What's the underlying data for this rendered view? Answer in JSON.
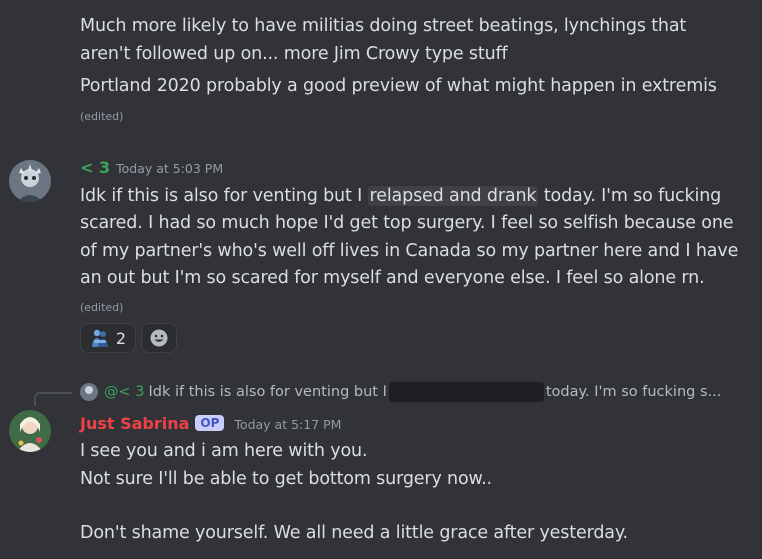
{
  "messages": {
    "prev": {
      "lines": [
        "Much more likely to have militias doing street beatings, lynchings that",
        "aren't followed up on... more Jim Crowy type stuff",
        "Portland 2020 probably a good preview of what might happen in extremis"
      ],
      "edited": "(edited)"
    },
    "lt3": {
      "username": "< 3",
      "username_color": "#3ba55c",
      "timestamp": "Today at 5:03 PM",
      "line1_before": "Idk if this is also for venting but I ",
      "line1_spoiler": "relapsed and drank",
      "line1_after": " today. I'm so fucking",
      "lines": [
        "scared. I had so much hope I'd get top surgery. I feel so selfish because one",
        "of my partner's who's well off lives in Canada so my partner here and I have",
        "an out but I'm so scared for myself and everyone else. I feel so alone rn."
      ],
      "edited": "(edited)",
      "reactions": [
        {
          "icon": "hugging-person-emoji",
          "count": "2"
        },
        {
          "icon": "add-reaction-icon",
          "count": ""
        }
      ]
    },
    "sabrina": {
      "reply_username": "@< 3",
      "reply_text_before": "Idk if this is also for venting but I",
      "reply_text_after": "today. I'm so fucking s...",
      "username": "Just Sabrina",
      "username_color": "#ed4245",
      "badge": "OP",
      "timestamp": "Today at 5:17 PM",
      "lines": [
        "I see you and i am here with you.",
        "Not sure I'll be able to get bottom surgery now..",
        "",
        "Don't shame yourself. We all need a little grace after yesterday."
      ]
    }
  }
}
